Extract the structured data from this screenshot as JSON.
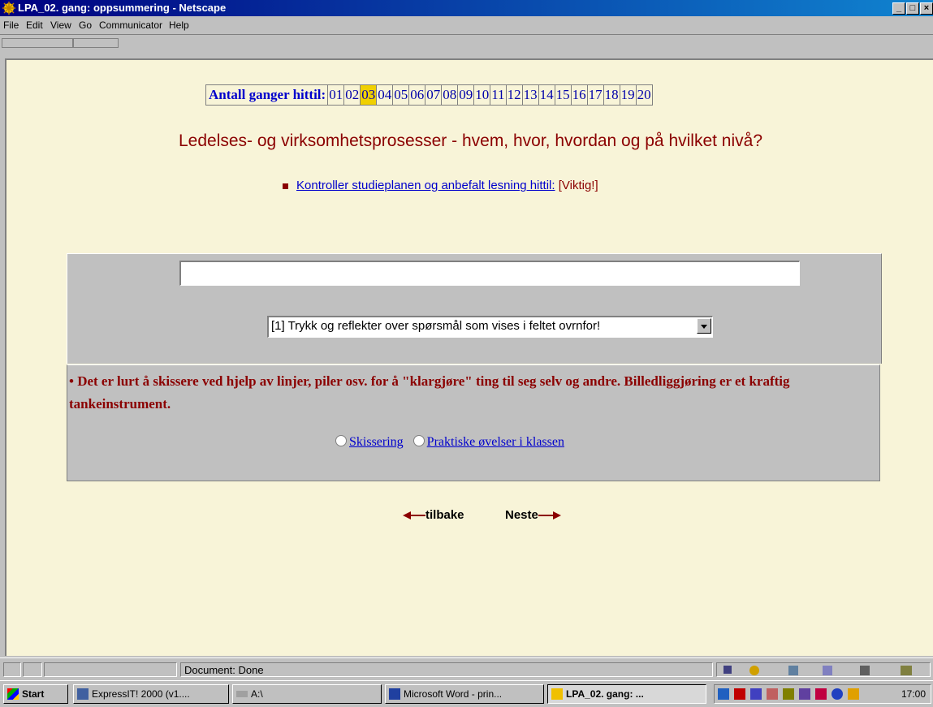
{
  "window": {
    "title": "LPA_02. gang: oppsummering - Netscape",
    "minimize": "_",
    "maximize": "□",
    "close": "×"
  },
  "menu": [
    "File",
    "Edit",
    "View",
    "Go",
    "Communicator",
    "Help"
  ],
  "counter": {
    "label": "Antall ganger hittil:",
    "numbers": [
      "01",
      "02",
      "03",
      "04",
      "05",
      "06",
      "07",
      "08",
      "09",
      "10",
      "11",
      "12",
      "13",
      "14",
      "15",
      "16",
      "17",
      "18",
      "19",
      "20"
    ],
    "active": "03"
  },
  "heading": "Ledelses- og virksomhetsprosesser - hvem, hvor, hvordan og på hvilket nivå?",
  "study_link": {
    "text": "Kontroller studieplanen og anbefalt lesning hittil:",
    "note": "[Viktig!]"
  },
  "question_field": {
    "value": ""
  },
  "question_select": {
    "value": "[1] Trykk og reflekter over spørsmål som vises i feltet ovrnfor!"
  },
  "tip": {
    "bullet": "•",
    "text": "Det er lurt å skissere ved hjelp av linjer, piler osv. for å \"klargjøre\" ting til seg selv og andre. Billedliggjøring er et kraftig tankeinstrument."
  },
  "options": [
    "Skissering",
    "Praktiske øvelser i klassen"
  ],
  "nav": {
    "back": "tilbake",
    "next": "Neste"
  },
  "status": {
    "text": "Document: Done"
  },
  "taskbar": {
    "start": "Start",
    "items": [
      "ExpressIT! 2000 (v1....",
      "A:\\",
      "Microsoft Word - prin...",
      "LPA_02. gang: ..."
    ],
    "clock": "17:00"
  },
  "colors": {
    "title_bg": "#000080",
    "page_bg": "#f8f4d8",
    "heading": "#8b0000",
    "link": "#0000cc",
    "highlight": "#f0d000"
  }
}
